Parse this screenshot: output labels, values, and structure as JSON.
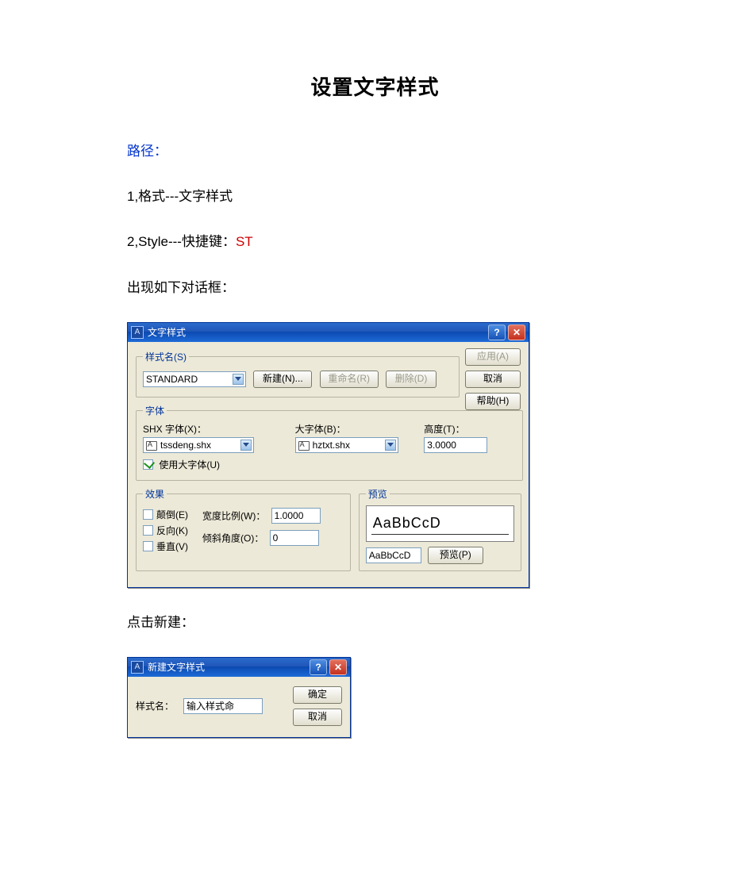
{
  "doc": {
    "heading": "设置文字样式",
    "path_label": "路径：",
    "line1": "1,格式---文字样式",
    "line2_prefix": "2,Style---快捷键：",
    "line2_shortcut": "ST",
    "line3": "出现如下对话框：",
    "line4": "点击新建："
  },
  "dialog1": {
    "title": "文字样式",
    "help_glyph": "?",
    "close_glyph": "✕",
    "style_name": {
      "legend": "样式名(S)",
      "selected": "STANDARD",
      "new_btn": "新建(N)...",
      "rename_btn": "重命名(R)",
      "delete_btn": "删除(D)"
    },
    "font": {
      "legend": "字体",
      "shx_label": "SHX 字体(X)：",
      "shx_value": "tssdeng.shx",
      "big_label": "大字体(B)：",
      "big_value": "hztxt.shx",
      "height_label": "高度(T)：",
      "height_value": "3.0000",
      "use_bigfont": "使用大字体(U)",
      "use_bigfont_checked": true
    },
    "effects": {
      "legend": "效果",
      "upside": "颠倒(E)",
      "backward": "反向(K)",
      "vertical": "垂直(V)",
      "width_label": "宽度比例(W)：",
      "width_value": "1.0000",
      "oblique_label": "倾斜角度(O)：",
      "oblique_value": "0"
    },
    "preview": {
      "legend": "预览",
      "sample_big": "AaBbCcD",
      "sample_small": "AaBbCcD",
      "preview_btn": "预览(P)"
    },
    "right": {
      "apply": "应用(A)",
      "cancel": "取消",
      "help": "帮助(H)"
    }
  },
  "dialog2": {
    "title": "新建文字样式",
    "help_glyph": "?",
    "close_glyph": "✕",
    "name_label": "样式名：",
    "name_value": "输入样式命",
    "ok": "确定",
    "cancel": "取消"
  }
}
